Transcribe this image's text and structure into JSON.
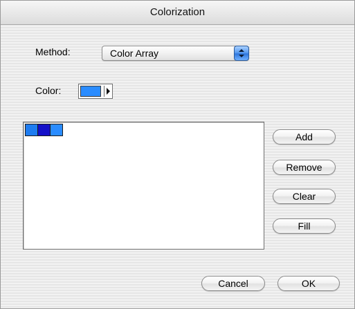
{
  "window": {
    "title": "Colorization"
  },
  "method": {
    "label": "Method:",
    "selected": "Color Array"
  },
  "color": {
    "label": "Color:",
    "current": "#2a8cff"
  },
  "color_list": {
    "cells": [
      {
        "color": "#1e7cf0"
      },
      {
        "color": "#1410c8"
      },
      {
        "color": "#2a8cff"
      }
    ]
  },
  "side_buttons": {
    "add": "Add",
    "remove": "Remove",
    "clear": "Clear",
    "fill": "Fill"
  },
  "footer": {
    "cancel": "Cancel",
    "ok": "OK"
  }
}
